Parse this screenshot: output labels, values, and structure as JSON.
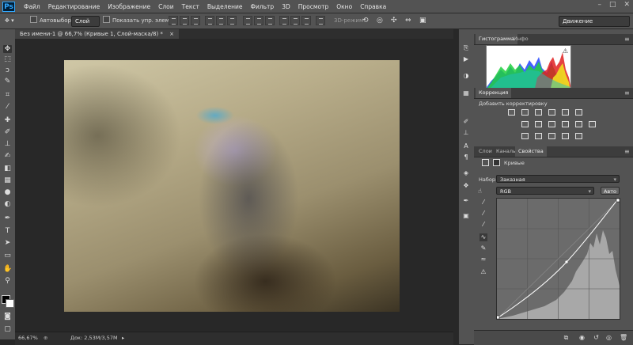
{
  "app": {
    "logo": "Ps"
  },
  "menu": [
    "Файл",
    "Редактирование",
    "Изображение",
    "Слои",
    "Текст",
    "Выделение",
    "Фильтр",
    "3D",
    "Просмотр",
    "Окно",
    "Справка"
  ],
  "window_controls": [
    "–",
    "□",
    "✕"
  ],
  "options": {
    "autoselect_label": "Автовыбор:",
    "autoselect_value": "Слой",
    "show_controls_label": "Показать упр. элем.",
    "mode_3d": "3D-режим:",
    "workspace": "Движение"
  },
  "document": {
    "tab_title": "Без имени-1 @ 66,7% (Кривые 1, Слой-маска/8) *",
    "tab_close": "×",
    "zoom": "66,67%",
    "doc_info": "Док: 2,53М/3,57М"
  },
  "panels": {
    "histogram_tabs": [
      "Гистограмма",
      "Инфо"
    ],
    "adjustments_tab": "Коррекция",
    "adjustments_title": "Добавить корректировку",
    "properties_tabs": [
      "Слои",
      "Каналы",
      "Свойства"
    ],
    "properties_title": "Кривые",
    "preset_label": "Набор:",
    "preset_value": "Заказная",
    "channel_value": "RGB",
    "auto_label": "Авто"
  },
  "colors": {
    "histogram_red": "#e02020",
    "histogram_green": "#20d040",
    "histogram_blue": "#3050ff",
    "histogram_yellow": "#f0e020",
    "warning": "#ffffff"
  },
  "icons": {
    "histogram_warning": "warning-icon"
  }
}
